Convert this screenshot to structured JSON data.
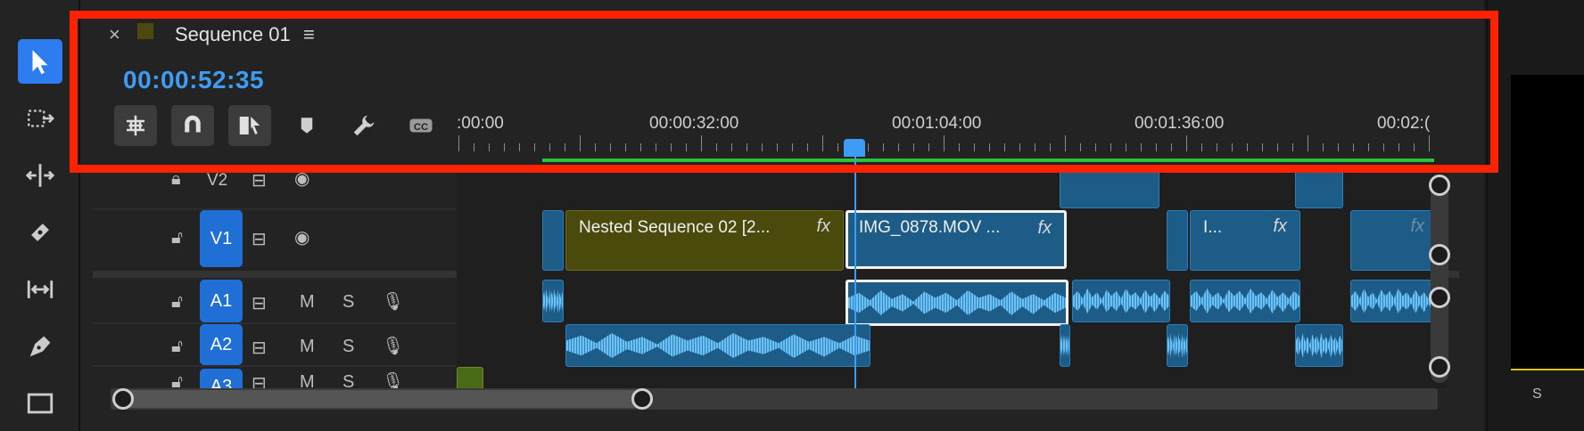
{
  "panel": {
    "close_label": "×",
    "sequence_title": "Sequence 01",
    "menu_icon": "hamburger-menu-icon",
    "timecode": "00:00:52:35"
  },
  "toolbar": {
    "buttons": [
      {
        "name": "insert-nest-icon"
      },
      {
        "name": "snap-magnet-icon"
      },
      {
        "name": "linked-selection-icon"
      },
      {
        "name": "add-marker-icon"
      },
      {
        "name": "wrench-settings-icon"
      },
      {
        "name": "captions-cc-icon"
      }
    ]
  },
  "ruler": {
    "labels": [
      ":00:00",
      "00:00:32:00",
      "00:01:04:00",
      "00:01:36:00",
      "00:02:("
    ]
  },
  "tracks": {
    "v2": {
      "label": "V2"
    },
    "v1": {
      "label": "V1"
    },
    "a1": {
      "label": "A1",
      "mute": "M",
      "solo": "S"
    },
    "a2": {
      "label": "A2",
      "mute": "M",
      "solo": "S"
    },
    "a3": {
      "label": "A3",
      "mute": "M",
      "solo": "S"
    }
  },
  "clips": {
    "nested": {
      "label": "Nested Sequence 02 [2...",
      "fx": "fx"
    },
    "img": {
      "label": "IMG_0878.MOV ...",
      "fx": "fx"
    },
    "short": {
      "label": "I...",
      "fx": "fx"
    },
    "last": {
      "fx": "fx"
    }
  },
  "right_pane": {
    "label": "S"
  },
  "colors": {
    "accent_blue": "#3e9cf5",
    "work_area_green": "#2ec13d",
    "highlight_red": "#ff2200",
    "nested_clip": "#4a4a0c",
    "video_clip": "#1c5c86"
  }
}
